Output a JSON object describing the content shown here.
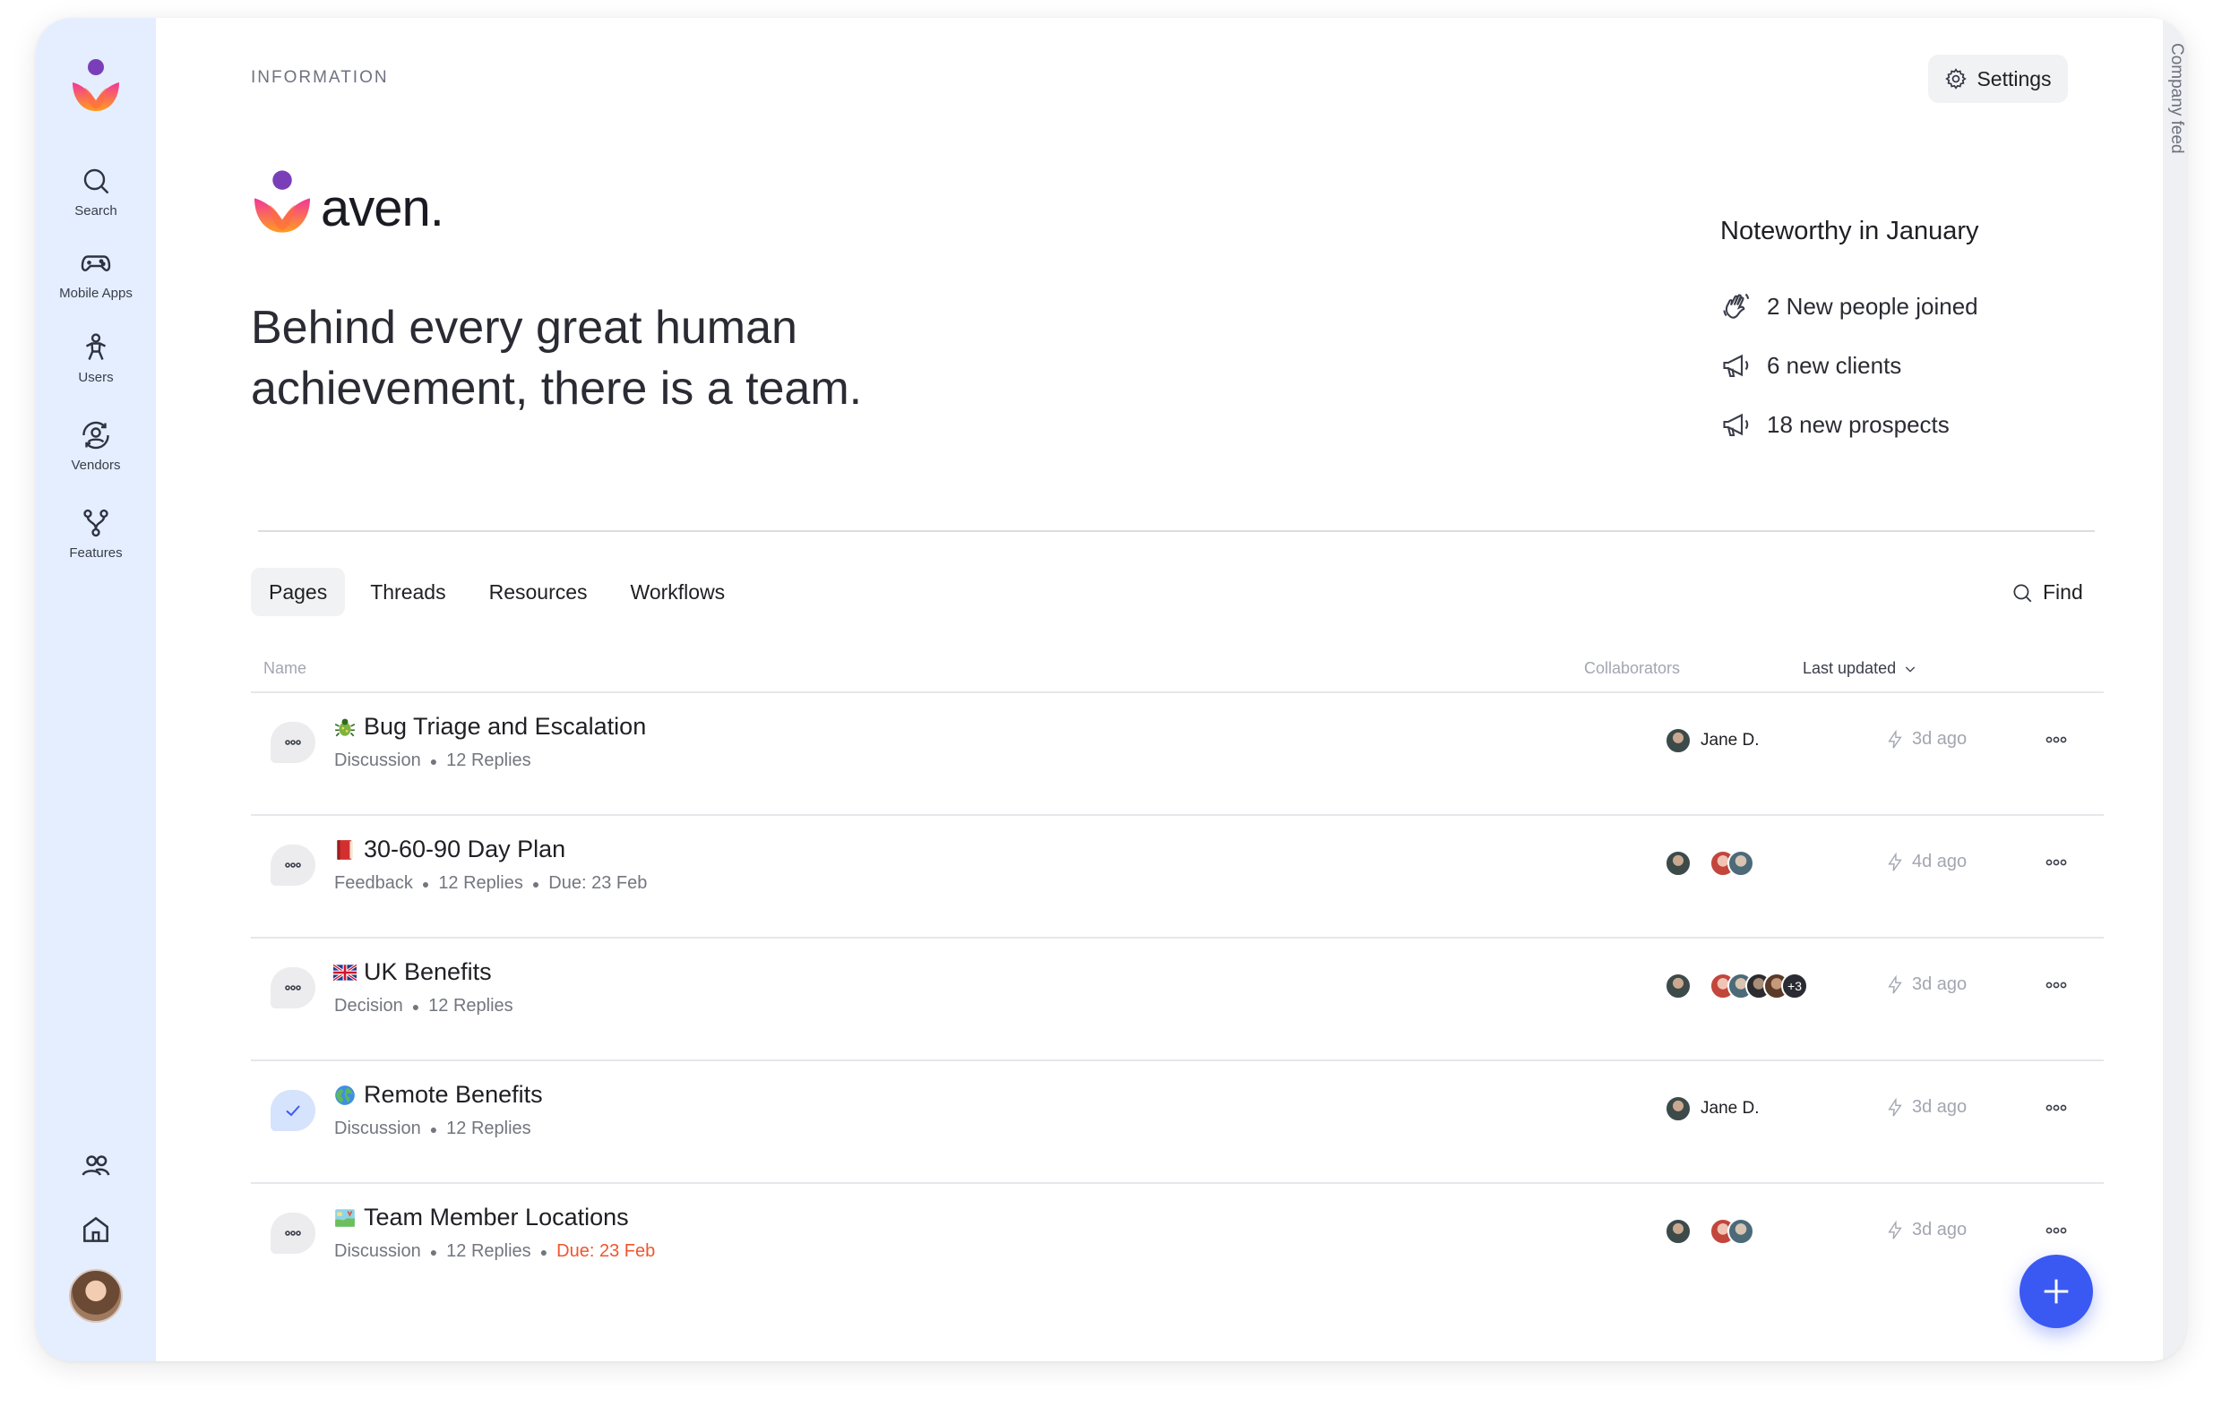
{
  "sidebar": {
    "items": [
      {
        "label": "Search",
        "icon": "search-icon"
      },
      {
        "label": "Mobile Apps",
        "icon": "gamepad-icon"
      },
      {
        "label": "Users",
        "icon": "person-icon"
      },
      {
        "label": "Vendors",
        "icon": "vendor-icon"
      },
      {
        "label": "Features",
        "icon": "branch-icon"
      }
    ],
    "bottom_icons": [
      "people-icon",
      "home-icon"
    ]
  },
  "header": {
    "eyebrow": "INFORMATION",
    "settings_label": "Settings"
  },
  "brand": {
    "wordmark": "aven."
  },
  "hero": {
    "headline_line1": "Behind every great human",
    "headline_line2": "achievement, there is a team."
  },
  "noteworthy": {
    "title": "Noteworthy in January",
    "items": [
      {
        "text": "2 New people joined",
        "icon": "wave-hand-icon"
      },
      {
        "text": "6 new clients",
        "icon": "megaphone-icon"
      },
      {
        "text": "18 new prospects",
        "icon": "megaphone-icon"
      }
    ]
  },
  "tabs": [
    {
      "label": "Pages",
      "active": true
    },
    {
      "label": "Threads",
      "active": false
    },
    {
      "label": "Resources",
      "active": false
    },
    {
      "label": "Workflows",
      "active": false
    }
  ],
  "find_label": "Find",
  "table": {
    "columns": {
      "name": "Name",
      "collaborators": "Collaborators",
      "updated": "Last updated"
    },
    "rows": [
      {
        "emoji": "bug",
        "title": "Bug Triage and Escalation",
        "type": "Discussion",
        "replies": "12 Replies",
        "due": "",
        "due_overdue": false,
        "collaborator_name": "Jane D.",
        "group_size": 0,
        "more_count": "",
        "updated": "3d ago",
        "status": "open"
      },
      {
        "emoji": "book",
        "title": "30-60-90 Day Plan",
        "type": "Feedback",
        "replies": "12 Replies",
        "due": "Due: 23 Feb",
        "due_overdue": false,
        "collaborator_name": "",
        "group_size": 2,
        "more_count": "",
        "updated": "4d ago",
        "status": "open"
      },
      {
        "emoji": "uk-flag",
        "title": "UK Benefits",
        "type": "Decision",
        "replies": "12 Replies",
        "due": "",
        "due_overdue": false,
        "collaborator_name": "",
        "group_size": 4,
        "more_count": "+3",
        "updated": "3d ago",
        "status": "open"
      },
      {
        "emoji": "globe",
        "title": "Remote Benefits",
        "type": "Discussion",
        "replies": "12 Replies",
        "due": "",
        "due_overdue": false,
        "collaborator_name": "Jane D.",
        "group_size": 0,
        "more_count": "",
        "updated": "3d ago",
        "status": "done"
      },
      {
        "emoji": "map",
        "title": "Team Member Locations",
        "type": "Discussion",
        "replies": "12 Replies",
        "due": "Due: 23 Feb",
        "due_overdue": true,
        "collaborator_name": "",
        "group_size": 2,
        "more_count": "",
        "updated": "3d ago",
        "status": "open"
      }
    ]
  },
  "right_rail": {
    "label": "Company feed"
  },
  "colors": {
    "sidebar_bg": "#e4eefe",
    "accent": "#3a59f2",
    "overdue": "#f0552d"
  }
}
